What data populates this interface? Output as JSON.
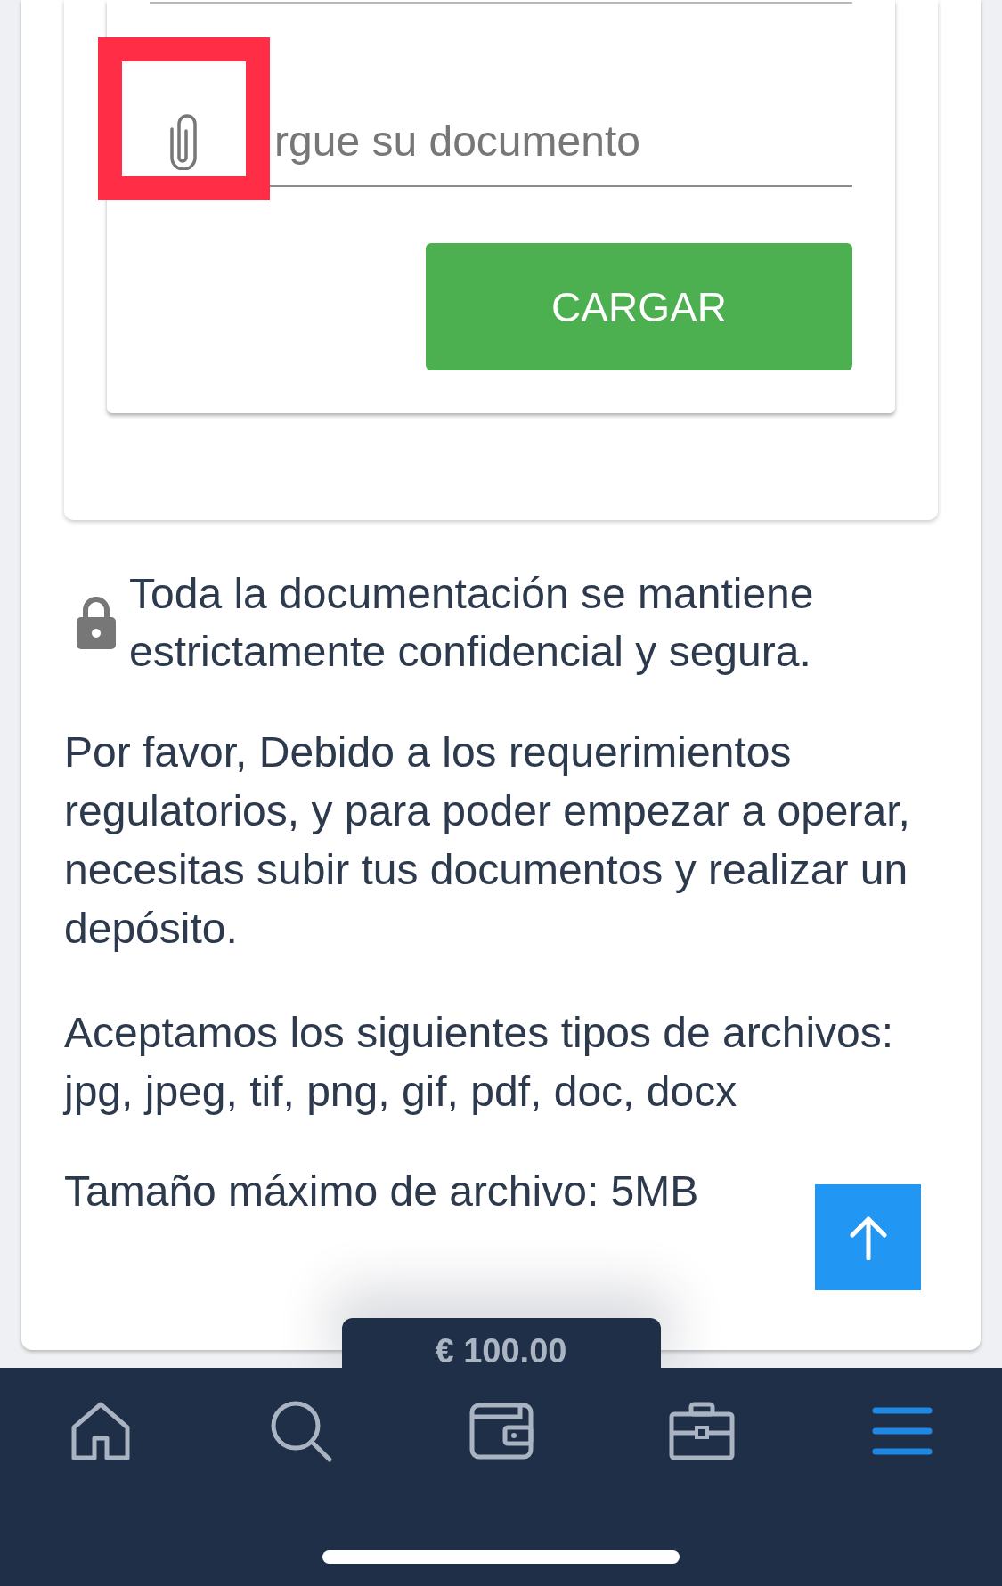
{
  "upload_field": {
    "placeholder": "rgue su documento",
    "highlighted": true
  },
  "upload_button": {
    "label": "CARGAR"
  },
  "security_note": "Toda la documentación se mantiene estrictamente confidencial y segura.",
  "regulatory_notice": "Por favor, Debido a los requerimientos regulatorios, y para poder empezar a operar, necesitas subir tus documentos y realizar un depósito.",
  "accepted_types": "Aceptamos los siguientes tipos de archivos: jpg, jpeg, tif, png, gif, pdf, doc, docx",
  "max_size": "Tamaño máximo de archivo: 5MB",
  "balance": "€ 100.00",
  "nav": {
    "items": [
      {
        "selected": false
      },
      {
        "selected": false
      },
      {
        "selected": false
      },
      {
        "selected": false
      },
      {
        "selected": true
      }
    ]
  }
}
